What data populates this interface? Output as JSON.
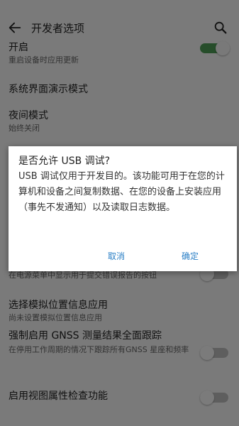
{
  "header": {
    "title": "开发者选项"
  },
  "icons": {
    "back": "arrow-left-icon",
    "search": "search-icon"
  },
  "settings": [
    {
      "title": "开启",
      "subtitle": "重启设备时应用更新",
      "toggle": true
    },
    {
      "title": "系统界面演示模式"
    },
    {
      "title": "夜间模式",
      "subtitle": "始终关闭"
    },
    {
      "title": "",
      "subtitle": "在电源菜单中显示用于提交错误报告的按钮"
    },
    {
      "title": "选择模拟位置信息应用",
      "subtitle": "尚未设置模拟位置信息应用"
    },
    {
      "title": "强制启用 GNSS 测量结果全面跟踪",
      "subtitle": "在停用工作周期的情况下跟踪所有GNSS 星座和频率",
      "toggle": false
    },
    {
      "title": "启用视图属性检查功能",
      "toggle": false
    }
  ],
  "dialog": {
    "title": "是否允许 USB 调试?",
    "message": "USB 调试仅用于开发目的。该功能可用于在您的计算机和设备之间复制数据、在您的设备上安装应用（事先不发通知）以及读取日志数据。",
    "cancel_label": "取消",
    "ok_label": "确定"
  },
  "colors": {
    "accent": "#2a7fc6",
    "toggle_on": "#4c9a54"
  }
}
